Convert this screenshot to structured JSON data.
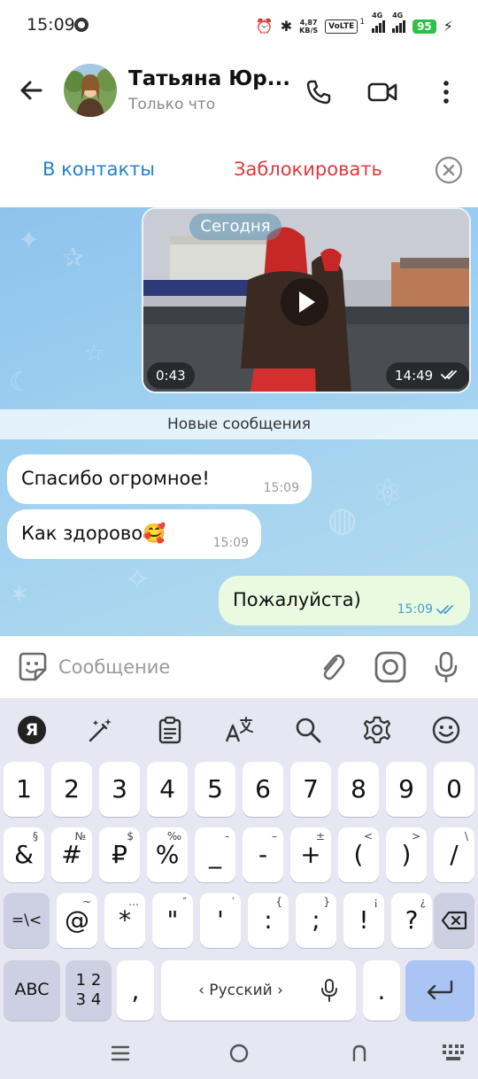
{
  "status_bar": {
    "time": "15:09",
    "net_speed_value": "4,87",
    "net_speed_unit": "KB/S",
    "volte": "VoLTE",
    "sim1_index": "1",
    "sim1_type": "4G",
    "sim2_type": "4G",
    "battery": "95"
  },
  "header": {
    "contact_name": "Татьяна Юр...",
    "status": "Только что"
  },
  "action_bar": {
    "add_contact": "В контакты",
    "block": "Заблокировать"
  },
  "chat": {
    "date_label": "Сегодня",
    "video": {
      "duration": "0:43",
      "time": "14:49"
    },
    "new_messages_label": "Новые сообщения",
    "messages": [
      {
        "direction": "in",
        "text": "Спасибо огромное!",
        "time": "15:09"
      },
      {
        "direction": "in",
        "text": "Как здорово🥰",
        "time": "15:09"
      },
      {
        "direction": "out",
        "text": "Пожалуйста)",
        "time": "15:09"
      }
    ]
  },
  "input": {
    "placeholder": "Сообщение"
  },
  "keyboard": {
    "logo": "Я",
    "space_label": "‹ Русский ›",
    "rows": [
      [
        {
          "main": "1",
          "sup": ""
        },
        {
          "main": "2",
          "sup": ""
        },
        {
          "main": "3",
          "sup": ""
        },
        {
          "main": "4",
          "sup": ""
        },
        {
          "main": "5",
          "sup": ""
        },
        {
          "main": "6",
          "sup": ""
        },
        {
          "main": "7",
          "sup": ""
        },
        {
          "main": "8",
          "sup": ""
        },
        {
          "main": "9",
          "sup": ""
        },
        {
          "main": "0",
          "sup": ""
        }
      ],
      [
        {
          "main": "&",
          "sup": "§"
        },
        {
          "main": "#",
          "sup": "№"
        },
        {
          "main": "₽",
          "sup": "$"
        },
        {
          "main": "%",
          "sup": "‰"
        },
        {
          "main": "_",
          "sup": "-"
        },
        {
          "main": "-",
          "sup": "–"
        },
        {
          "main": "+",
          "sup": "±"
        },
        {
          "main": "(",
          "sup": "<"
        },
        {
          "main": ")",
          "sup": ">"
        },
        {
          "main": "/",
          "sup": "\\"
        }
      ],
      [
        {
          "main": "=\\<",
          "sup": ""
        },
        {
          "main": "@",
          "sup": "~"
        },
        {
          "main": "*",
          "sup": "…"
        },
        {
          "main": "\"",
          "sup": "″"
        },
        {
          "main": "'",
          "sup": "′"
        },
        {
          "main": ":",
          "sup": "{"
        },
        {
          "main": ";",
          "sup": "}"
        },
        {
          "main": "!",
          "sup": "¡"
        },
        {
          "main": "?",
          "sup": "¿"
        }
      ],
      [
        {
          "main": "ABC",
          "sup": ""
        },
        {
          "main": "1 2 3 4",
          "sup": ""
        },
        {
          "main": ",",
          "sup": ""
        },
        {
          "main": ".",
          "sup": ""
        }
      ]
    ]
  },
  "colors": {
    "accent_blue": "#2481cc",
    "danger_red": "#e0383e",
    "outgoing_bubble": "#e9fae0",
    "keyboard_bg": "#e6e7f2"
  }
}
